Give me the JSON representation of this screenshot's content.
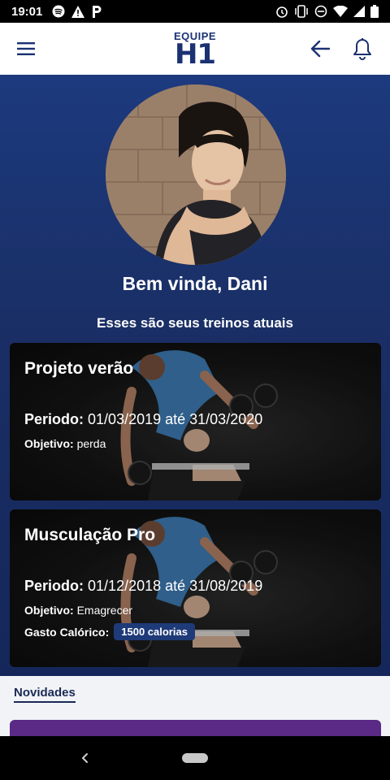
{
  "status_bar": {
    "time": "19:01",
    "left_icons": [
      "spotify-icon",
      "warning-icon",
      "parking-icon"
    ],
    "right_icons": [
      "alarm-icon",
      "vibrate-icon",
      "do-not-disturb-icon",
      "wifi-icon",
      "signal-icon",
      "battery-icon"
    ]
  },
  "app_bar": {
    "logo_top": "EQUIPE",
    "logo_bottom": "H1",
    "brand_color": "#1b3172"
  },
  "profile": {
    "welcome": "Bem vinda, Dani",
    "subtitle": "Esses são seus treinos atuais"
  },
  "workouts": [
    {
      "title": "Projeto verão",
      "period_label": "Periodo:",
      "period_value": "01/03/2019 até 31/03/2020",
      "objective_label": "Objetivo:",
      "objective_value": "perda"
    },
    {
      "title": "Musculação Pro",
      "period_label": "Periodo:",
      "period_value": "01/12/2018 até 31/08/2019",
      "objective_label": "Objetivo:",
      "objective_value": "Emagrecer",
      "calorie_label": "Gasto Calórico:",
      "calorie_value": "1500 calorias"
    }
  ],
  "news_tab": "Novidades",
  "colors": {
    "hero_bg": "#1a2f66",
    "badge_bg": "#1e3a78",
    "purple_card": "#5a2a86"
  }
}
